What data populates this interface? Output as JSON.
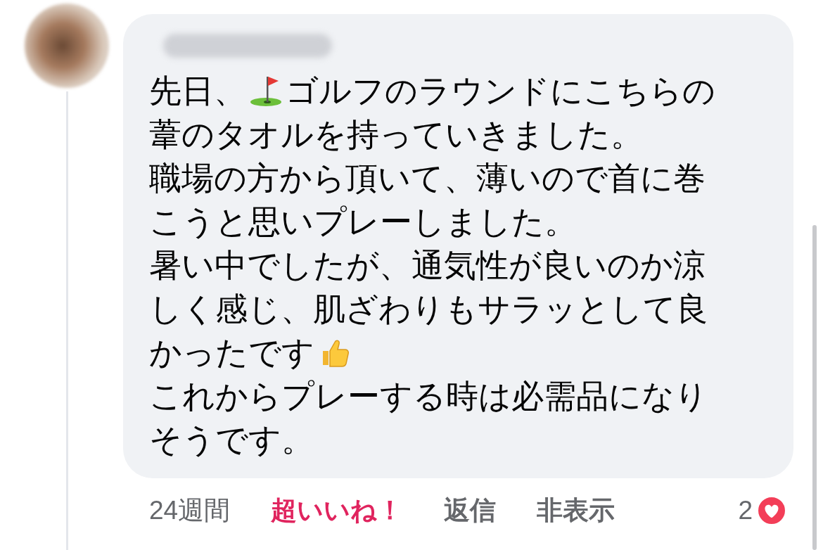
{
  "comment": {
    "lines": [
      {
        "parts": [
          {
            "kind": "text",
            "text": "先日、"
          },
          {
            "kind": "golf"
          },
          {
            "kind": "text",
            "text": "ゴルフのラウンドにこちらの"
          }
        ]
      },
      {
        "parts": [
          {
            "kind": "text",
            "text": "葦のタオルを持っていきました。"
          }
        ]
      },
      {
        "parts": [
          {
            "kind": "text",
            "text": "職場の方から頂いて、薄いので首に巻"
          }
        ]
      },
      {
        "parts": [
          {
            "kind": "text",
            "text": "こうと思いプレーしました。"
          }
        ]
      },
      {
        "parts": [
          {
            "kind": "text",
            "text": "暑い中でしたが、通気性が良いのか涼"
          }
        ]
      },
      {
        "parts": [
          {
            "kind": "text",
            "text": "しく感じ、肌ざわりもサラッとして良"
          }
        ]
      },
      {
        "parts": [
          {
            "kind": "text",
            "text": "かったです"
          },
          {
            "kind": "thumbs"
          }
        ]
      },
      {
        "parts": [
          {
            "kind": "text",
            "text": "これからプレーする時は必需品になり"
          }
        ]
      },
      {
        "parts": [
          {
            "kind": "text",
            "text": "そうです。"
          }
        ]
      }
    ]
  },
  "footer": {
    "time": "24週間",
    "reaction": "超いいね！",
    "reacted": true,
    "reply": "返信",
    "hide": "非表示",
    "reaction_count": "2"
  }
}
